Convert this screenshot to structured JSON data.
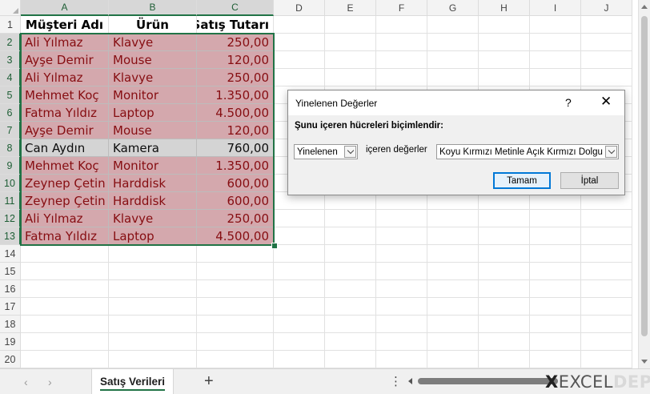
{
  "sheet": {
    "columns": [
      "A",
      "B",
      "C",
      "D",
      "E",
      "F",
      "G",
      "H",
      "I",
      "J"
    ],
    "row_numbers": [
      "1",
      "2",
      "3",
      "4",
      "5",
      "6",
      "7",
      "8",
      "9",
      "10",
      "11",
      "12",
      "13",
      "14",
      "15",
      "16",
      "17",
      "18",
      "19",
      "20"
    ],
    "header_row": [
      "Müşteri Adı",
      "Ürün",
      "Satış Tutarı"
    ],
    "rows": [
      {
        "name": "Ali Yılmaz",
        "product": "Klavye",
        "amount": "250,00",
        "duplicate": true
      },
      {
        "name": "Ayşe Demir",
        "product": "Mouse",
        "amount": "120,00",
        "duplicate": true
      },
      {
        "name": "Ali Yılmaz",
        "product": "Klavye",
        "amount": "250,00",
        "duplicate": true
      },
      {
        "name": "Mehmet Koç",
        "product": "Monitor",
        "amount": "1.350,00",
        "duplicate": true
      },
      {
        "name": "Fatma Yıldız",
        "product": "Laptop",
        "amount": "4.500,00",
        "duplicate": true
      },
      {
        "name": "Ayşe Demir",
        "product": "Mouse",
        "amount": "120,00",
        "duplicate": true
      },
      {
        "name": "Can Aydın",
        "product": "Kamera",
        "amount": "760,00",
        "duplicate": false
      },
      {
        "name": "Mehmet Koç",
        "product": "Monitor",
        "amount": "1.350,00",
        "duplicate": true
      },
      {
        "name": "Zeynep Çetin",
        "product": "Harddisk",
        "amount": "600,00",
        "duplicate": true
      },
      {
        "name": "Zeynep Çetin",
        "product": "Harddisk",
        "amount": "600,00",
        "duplicate": true
      },
      {
        "name": "Ali Yılmaz",
        "product": "Klavye",
        "amount": "250,00",
        "duplicate": true
      },
      {
        "name": "Fatma Yıldız",
        "product": "Laptop",
        "amount": "4.500,00",
        "duplicate": true
      }
    ],
    "selected_columns": [
      "A",
      "B",
      "C"
    ],
    "selected_rows": [
      "2",
      "3",
      "4",
      "5",
      "6",
      "7",
      "8",
      "9",
      "10",
      "11",
      "12",
      "13"
    ]
  },
  "dialog": {
    "title": "Yinelenen Değerler",
    "help": "?",
    "close": "✕",
    "prompt": "Şunu içeren hücreleri biçimlendir:",
    "type_value": "Yinelenen",
    "middle_text": "içeren değerler",
    "format_value": "Koyu Kırmızı Metinle Açık Kırmızı Dolgu",
    "ok_label": "Tamam",
    "cancel_label": "İptal"
  },
  "tabs": {
    "prev": "‹",
    "next": "›",
    "active_tab": "Satış Verileri",
    "add": "+",
    "more": "⋮"
  },
  "watermark": {
    "x": "X",
    "excel": "EXCEL",
    "depo": "DEPO"
  },
  "colors": {
    "dup_fill": "#ffc7ce",
    "dup_text": "#9c0006",
    "accent": "#217346"
  }
}
